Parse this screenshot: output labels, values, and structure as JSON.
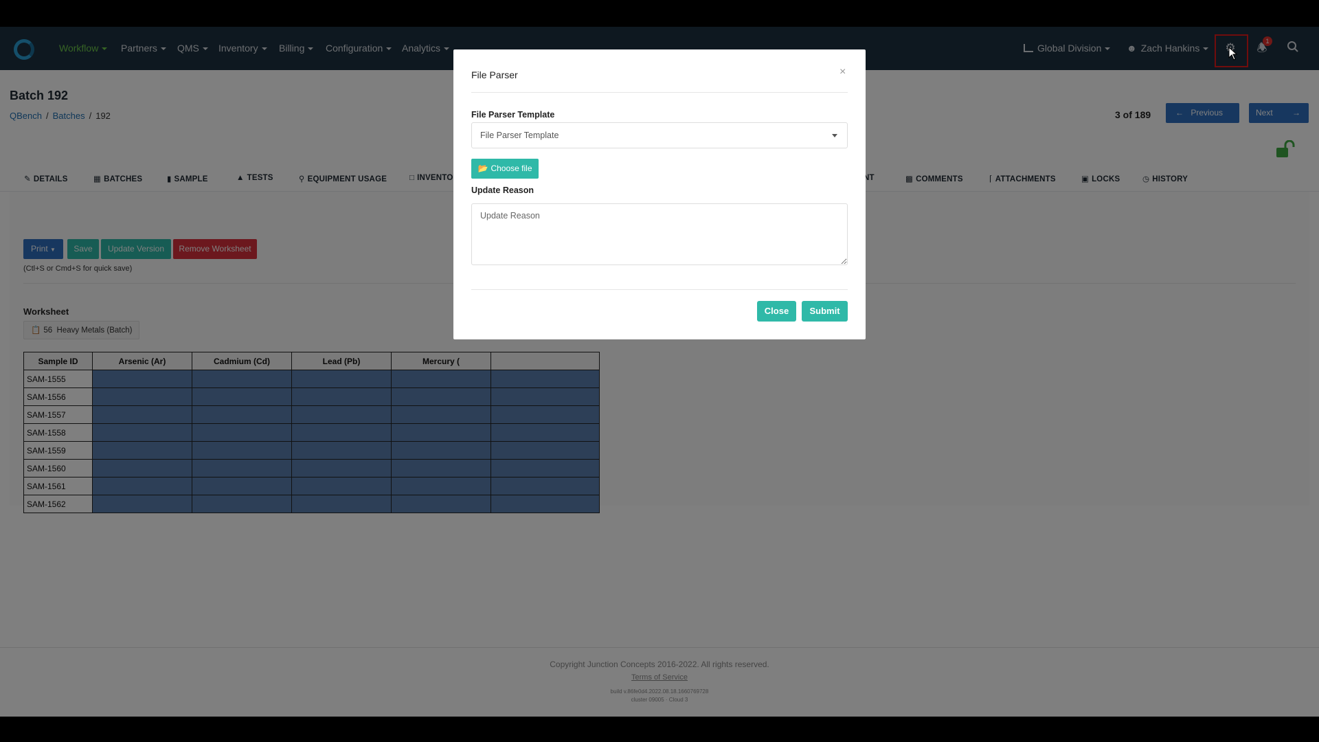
{
  "nav": {
    "menu": [
      {
        "label": "Workflow",
        "active": true
      },
      {
        "label": "Partners"
      },
      {
        "label": "QMS"
      },
      {
        "label": "Inventory"
      },
      {
        "label": "Billing"
      },
      {
        "label": "Configuration"
      },
      {
        "label": "Analytics"
      }
    ],
    "division": "Global Division",
    "user": "Zach Hankins",
    "notification_count": "1"
  },
  "page": {
    "title": "Batch 192",
    "breadcrumb": [
      "QBench",
      "Batches",
      "192"
    ],
    "pager_text": "3 of 189",
    "previous_label": "Previous",
    "next_label": "Next"
  },
  "tabs": [
    "DETAILS",
    "BATCHES",
    "SAMPLE",
    "TESTS",
    "EQUIPMENT USAGE",
    "INVENTO",
    "NT",
    "COMMENTS",
    "ATTACHMENTS",
    "LOCKS",
    "HISTORY"
  ],
  "toolbar": {
    "print_label": "Print",
    "save_label": "Save",
    "update_version_label": "Update Version",
    "remove_worksheet_label": "Remove Worksheet",
    "hint": "(Ctl+S or Cmd+S for quick save)"
  },
  "worksheet": {
    "title": "Worksheet",
    "chip_id": "56",
    "chip_name": "Heavy Metals (Batch)",
    "columns": [
      "Sample ID",
      "Arsenic (Ar)",
      "Cadmium (Cd)",
      "Lead (Pb)",
      "Mercury (",
      ""
    ],
    "rows": [
      "SAM-1555",
      "SAM-1556",
      "SAM-1557",
      "SAM-1558",
      "SAM-1559",
      "SAM-1560",
      "SAM-1561",
      "SAM-1562"
    ]
  },
  "footer": {
    "copyright": "Copyright Junction Concepts 2016-2022. All rights reserved.",
    "terms": "Terms of Service",
    "build": "build v.86fe0d4.2022.08.18.1660769728",
    "cluster": "cluster 09005 · Cloud 3"
  },
  "modal": {
    "title": "File Parser",
    "close_x": "×",
    "template_label": "File Parser Template",
    "template_value": "File Parser Template",
    "choose_file_label": "Choose file",
    "reason_label": "Update Reason",
    "reason_placeholder": "Update Reason",
    "close_label": "Close",
    "submit_label": "Submit"
  },
  "colors": {
    "nav_bg": "#1d3040",
    "accent_teal": "#2fb9a8",
    "primary_blue": "#2e6fbf",
    "danger_red": "#d9313d",
    "cell_blue": "#5b7fae"
  }
}
